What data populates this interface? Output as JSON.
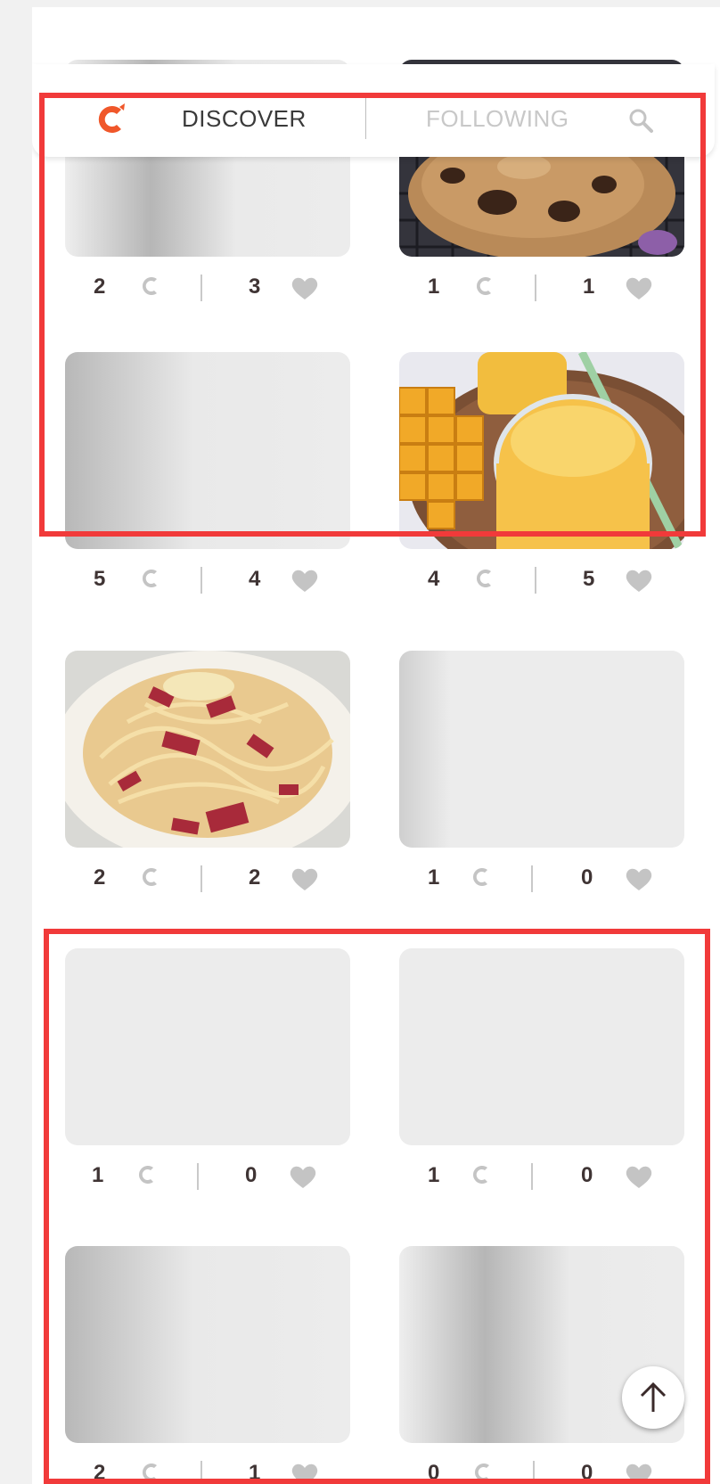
{
  "nav": {
    "discover_label": "DISCOVER",
    "following_label": "FOLLOWING",
    "logo_icon": "cookpad-c-logo",
    "search_icon": "search-icon"
  },
  "colors": {
    "brand_orange": "#f0572a",
    "teal": "#28bfc6",
    "highlight_red": "#f13a3a",
    "icon_gray": "#c4c4c4"
  },
  "cards": [
    {
      "image": "gray-placeholder",
      "cooks": "2",
      "likes": "3"
    },
    {
      "image": "cookie-photo",
      "cooks": "1",
      "likes": "1"
    },
    {
      "image": "gray-placeholder",
      "cooks": "5",
      "likes": "4"
    },
    {
      "image": "mango-smoothie-photo",
      "cooks": "4",
      "likes": "5"
    },
    {
      "image": "carbonara-photo",
      "cooks": "2",
      "likes": "2"
    },
    {
      "image": "gray-placeholder",
      "cooks": "1",
      "likes": "0"
    },
    {
      "image": "gray-placeholder",
      "cooks": "1",
      "likes": "0"
    },
    {
      "image": "gray-placeholder",
      "cooks": "1",
      "likes": "0"
    },
    {
      "image": "gray-placeholder",
      "cooks": "2",
      "likes": "1"
    },
    {
      "image": "gray-placeholder",
      "cooks": "0",
      "likes": "0"
    }
  ],
  "fab": {
    "icon": "arrow-up-icon"
  }
}
